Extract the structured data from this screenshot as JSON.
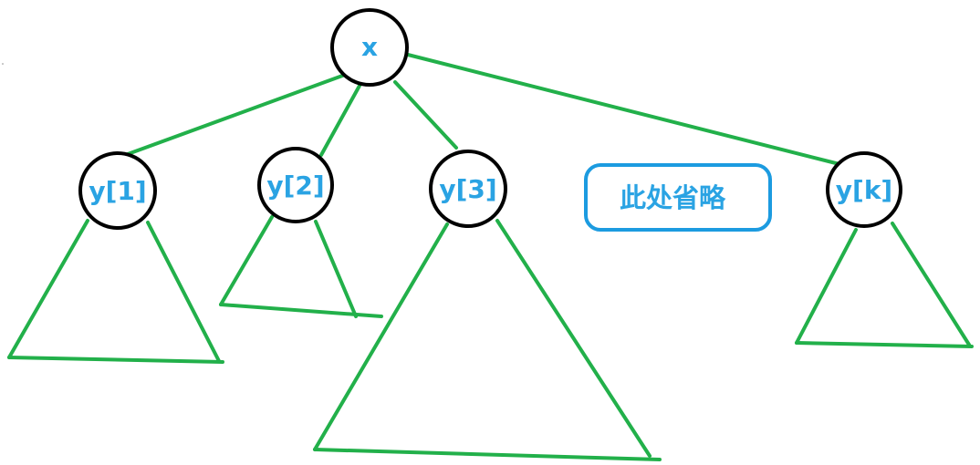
{
  "diagram": {
    "root": {
      "label": "x"
    },
    "children": [
      {
        "label": "y[1]"
      },
      {
        "label": "y[2]"
      },
      {
        "label": "y[3]"
      },
      {
        "label": "y[k]"
      }
    ],
    "omitted_note": "此处省略"
  },
  "colors": {
    "edge": "#22b04a",
    "node_outline": "#000000",
    "label": "#2aa3e3",
    "note_border": "#1c9be0"
  }
}
